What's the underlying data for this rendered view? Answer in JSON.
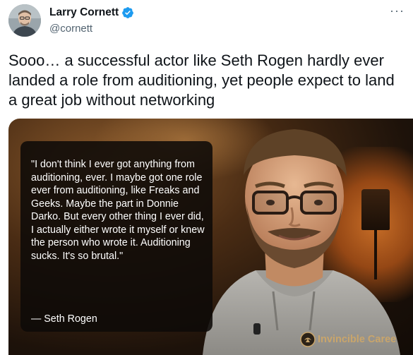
{
  "author": {
    "display_name": "Larry Cornett",
    "handle": "@cornett",
    "verified": true,
    "avatar_icon": "person-avatar"
  },
  "menu": {
    "more_icon": "more-horizontal-icon",
    "label": "···"
  },
  "tweet": {
    "text": "Sooo… a successful actor like Seth Rogen hardly ever landed a role from auditioning, yet people expect to land a great job without networking"
  },
  "media": {
    "quote": "\"I don't think I ever got anything from auditioning, ever. I maybe got one role ever from auditioning, like Freaks and Geeks. Maybe the part in Donnie Darko. But every other thing I ever did, I actually either wrote it myself or knew the person who wrote it. Auditioning sucks. It's so brutal.\"",
    "attribution": "— Seth Rogen",
    "watermark": "Invincible Caree"
  },
  "colors": {
    "verified_badge": "#1d9bf0",
    "secondary_text": "#536471",
    "watermark_text": "#c9a56b"
  }
}
